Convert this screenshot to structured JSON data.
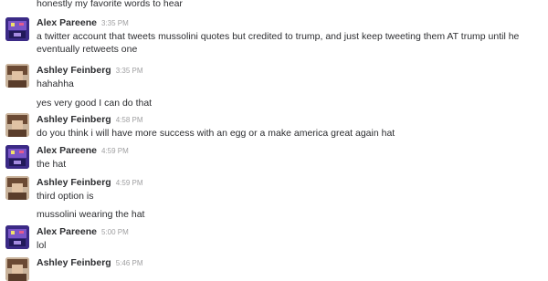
{
  "messages": [
    {
      "type": "continuation",
      "text": "honestly my favorite words to hear"
    },
    {
      "type": "header",
      "sender": "Alex Pareene",
      "timestamp": "3:35 PM",
      "avatar": "alex-avatar",
      "text": "a twitter account that tweets mussolini quotes but credited to trump, and just keep tweeting them AT trump until he eventually retweets one"
    },
    {
      "type": "header",
      "sender": "Ashley Feinberg",
      "timestamp": "3:35 PM",
      "avatar": "ashley-avatar",
      "text": "hahahha"
    },
    {
      "type": "continuation",
      "text": "yes very good I can do that"
    },
    {
      "type": "header",
      "sender": "Ashley Feinberg",
      "timestamp": "4:58 PM",
      "avatar": "ashley-avatar",
      "text": "do you think i will have more success  with an egg or a make america great again hat"
    },
    {
      "type": "header",
      "sender": "Alex Pareene",
      "timestamp": "4:59 PM",
      "avatar": "alex-avatar",
      "text": "the hat"
    },
    {
      "type": "header",
      "sender": "Ashley Feinberg",
      "timestamp": "4:59 PM",
      "avatar": "ashley-avatar",
      "text": "third option is"
    },
    {
      "type": "continuation",
      "text": "mussolini wearing the hat"
    },
    {
      "type": "header",
      "sender": "Alex Pareene",
      "timestamp": "5:00 PM",
      "avatar": "alex-avatar",
      "text": "lol"
    },
    {
      "type": "header",
      "sender": "Ashley Feinberg",
      "timestamp": "5:46 PM",
      "avatar": "ashley-avatar",
      "text": ""
    }
  ]
}
